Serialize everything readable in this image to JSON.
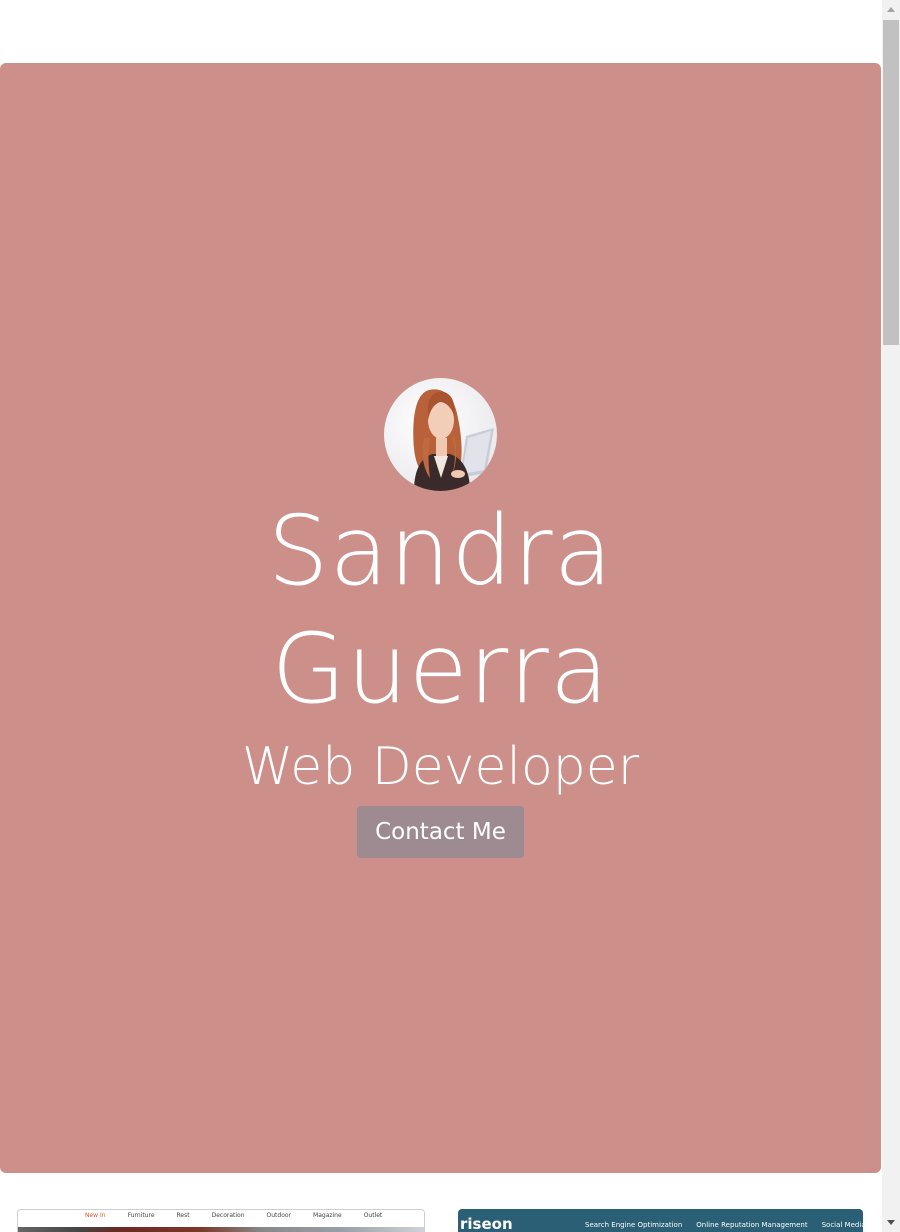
{
  "hero": {
    "first_name": "Sandra",
    "last_name": "Guerra",
    "role": "Web Developer",
    "contact_label": "Contact Me",
    "background_color": "#cd8f8a",
    "button_color": "#9d8b91"
  },
  "portfolio": {
    "left_thumb_nav": [
      "New In",
      "Furniture",
      "Rest",
      "Decoration",
      "Outdoor",
      "Magazine",
      "Outlet"
    ],
    "right_thumb_brand": "riseon",
    "right_thumb_links": [
      "Search Engine Optimization",
      "Online Reputation Management",
      "Social Media Mark"
    ]
  }
}
